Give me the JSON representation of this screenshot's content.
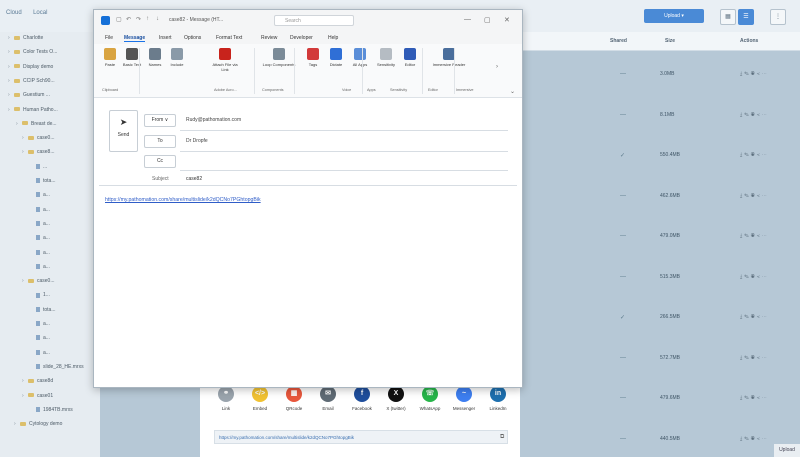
{
  "background_app": {
    "tabs": [
      "Cloud",
      "Local"
    ],
    "upload_label": "Upload",
    "upload_tab": "Upload",
    "header": {
      "shared": "Shared",
      "size": "Size",
      "actions": "Actions"
    },
    "tree": [
      {
        "label": "Charlotte",
        "type": "folder"
      },
      {
        "label": "Color Tests O...",
        "type": "folder"
      },
      {
        "label": "Display demo",
        "type": "folder"
      },
      {
        "label": "CCIP Sch90...",
        "type": "folder"
      },
      {
        "label": "Guestium ...",
        "type": "folder"
      },
      {
        "label": "Human Patho...",
        "type": "folder"
      },
      {
        "label": "Breast de...",
        "type": "folder"
      },
      {
        "label": "case0...",
        "type": "folder"
      },
      {
        "label": "case8...",
        "type": "folder"
      },
      {
        "label": "...",
        "type": "file"
      },
      {
        "label": "tota...",
        "type": "file"
      },
      {
        "label": "a...",
        "type": "file"
      },
      {
        "label": "a...",
        "type": "file"
      },
      {
        "label": "a...",
        "type": "file"
      },
      {
        "label": "a...",
        "type": "file"
      },
      {
        "label": "a...",
        "type": "file"
      },
      {
        "label": "a...",
        "type": "file"
      },
      {
        "label": "case0...",
        "type": "folder"
      },
      {
        "label": "1...",
        "type": "file"
      },
      {
        "label": "tota...",
        "type": "file"
      },
      {
        "label": "a...",
        "type": "file"
      },
      {
        "label": "a...",
        "type": "file"
      },
      {
        "label": "a...",
        "type": "file"
      },
      {
        "label": "slide_28_HE.mrxs",
        "type": "file"
      },
      {
        "label": "case8d",
        "type": "folder"
      },
      {
        "label": "case01",
        "type": "folder"
      },
      {
        "label": "1984TB.mrxs",
        "type": "file"
      },
      {
        "label": "Cytology demo",
        "type": "folder"
      }
    ],
    "rows": [
      {
        "shared": "—",
        "size": "3.0MB"
      },
      {
        "shared": "—",
        "size": "8.1MB"
      },
      {
        "shared": "✓",
        "size": "550.4MB"
      },
      {
        "shared": "—",
        "size": "462.6MB"
      },
      {
        "shared": "—",
        "size": "479.0MB"
      },
      {
        "shared": "—",
        "size": "515.3MB"
      },
      {
        "shared": "✓",
        "size": "266.5MB"
      },
      {
        "shared": "—",
        "size": "572.7MB"
      },
      {
        "shared": "—",
        "size": "479.6MB"
      },
      {
        "shared": "—",
        "size": "440.5MB"
      }
    ]
  },
  "share_sheet": {
    "items": [
      {
        "label": "Link",
        "icon": "link-icon",
        "color": "#9aa4ad",
        "glyph": "⚭"
      },
      {
        "label": "Embed",
        "icon": "embed-icon",
        "color": "#f1c232",
        "glyph": "</>"
      },
      {
        "label": "QRcode",
        "icon": "qrcode-icon",
        "color": "#e8573c",
        "glyph": "▦"
      },
      {
        "label": "Email",
        "icon": "email-icon",
        "color": "#5f6b75",
        "glyph": "✉"
      },
      {
        "label": "Facebook",
        "icon": "facebook-icon",
        "color": "#1f4e9c",
        "glyph": "f"
      },
      {
        "label": "X (twitter)",
        "icon": "x-icon",
        "color": "#111111",
        "glyph": "X"
      },
      {
        "label": "WhatsApp",
        "icon": "whatsapp-icon",
        "color": "#27b54a",
        "glyph": "☏"
      },
      {
        "label": "Messenger",
        "icon": "messenger-icon",
        "color": "#3d7ef0",
        "glyph": "~"
      },
      {
        "label": "LinkedIn",
        "icon": "linkedin-icon",
        "color": "#1d6fae",
        "glyph": "in"
      }
    ],
    "link": "https://my.pathomation.com/share/multislide/k2dQCNo7PGhtopgBik"
  },
  "compose": {
    "title": "case82 - Message (HT...",
    "search_placeholder": "Search",
    "menus": [
      "File",
      "Message",
      "Insert",
      "Options",
      "Format Text",
      "Review",
      "Developer",
      "Help"
    ],
    "active_menu": "Message",
    "ribbon": [
      {
        "label": "Paste",
        "color": "#d9a441"
      },
      {
        "label": "Basic Text",
        "color": "#555555"
      },
      {
        "label": "Names",
        "color": "#6b7c8c"
      },
      {
        "label": "Include",
        "color": "#8a9aa8"
      },
      {
        "label": "Attach File via Link",
        "color": "#c8231c"
      },
      {
        "label": "Loop Components",
        "color": "#7b8b98"
      },
      {
        "label": "Tags",
        "color": "#d23a3a"
      },
      {
        "label": "Dictate",
        "color": "#2f6fd6"
      },
      {
        "label": "All Apps",
        "color": "#5a8ed8"
      },
      {
        "label": "Sensitivity",
        "color": "#b5bcc3"
      },
      {
        "label": "Editor",
        "color": "#2f5bb7"
      },
      {
        "label": "Immersive Reader",
        "color": "#4a6e9c"
      }
    ],
    "groups": [
      "Clipboard",
      "Adobe Acro...",
      "Components",
      "Voice",
      "Apps",
      "Sensitivity",
      "Editor",
      "Immersive"
    ],
    "send_label": "Send",
    "from_label": "From",
    "from_value": "Rudy@pathomation.com",
    "to_label": "To",
    "to_value": "Dr Dropfe",
    "cc_label": "Cc",
    "subject_label": "Subject",
    "subject_value": "case82",
    "body_link": "https://my.pathomation.com/share/multislide/k2dQCNo7PGhtopgBik"
  }
}
